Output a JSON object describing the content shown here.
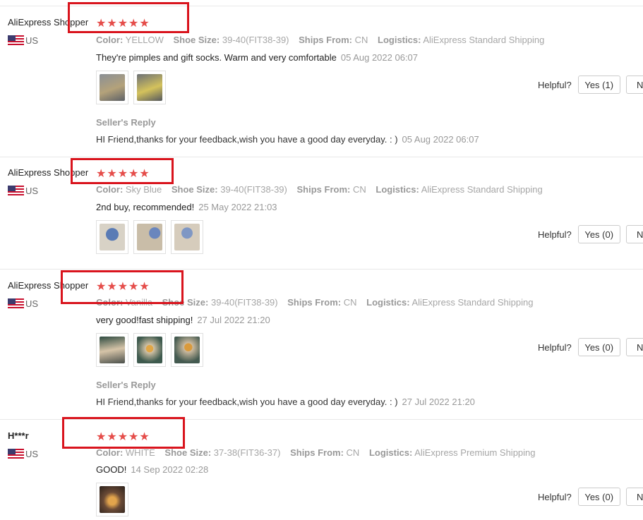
{
  "reviews": [
    {
      "user": "AliExpress Shopper",
      "country": "US",
      "stars": "★★★★★",
      "color_label": "Color:",
      "color": "YELLOW",
      "size_label": "Shoe Size:",
      "size": "39-40(FIT38-39)",
      "ships_label": "Ships From:",
      "ships": "CN",
      "logistics_label": "Logistics:",
      "logistics": "AliExpress Standard Shipping",
      "text": "They're pimples and gift socks. Warm and very comfortable",
      "date": "05 Aug 2022 06:07",
      "helpful_label": "Helpful?",
      "yes_label": "Yes (1)",
      "no_label": "N",
      "seller_reply_label": "Seller's Reply",
      "seller_reply": "HI Friend,thanks for your feedback,wish you have a good day everyday. : )",
      "seller_reply_date": "05 Aug 2022 06:07"
    },
    {
      "user": "AliExpress Shopper",
      "country": "US",
      "stars": "★★★★★",
      "color_label": "Color:",
      "color": "Sky Blue",
      "size_label": "Shoe Size:",
      "size": "39-40(FIT38-39)",
      "ships_label": "Ships From:",
      "ships": "CN",
      "logistics_label": "Logistics:",
      "logistics": "AliExpress Standard Shipping",
      "text": "2nd buy, recommended!",
      "date": "25 May 2022 21:03",
      "helpful_label": "Helpful?",
      "yes_label": "Yes (0)",
      "no_label": "N"
    },
    {
      "user": "AliExpress Shopper",
      "country": "US",
      "stars": "★★★★★",
      "color_label": "Color:",
      "color": "Vanilla",
      "size_label": "Shoe Size:",
      "size": "39-40(FIT38-39)",
      "ships_label": "Ships From:",
      "ships": "CN",
      "logistics_label": "Logistics:",
      "logistics": "AliExpress Standard Shipping",
      "text": "very good!fast shipping!",
      "date": "27 Jul 2022 21:20",
      "helpful_label": "Helpful?",
      "yes_label": "Yes (0)",
      "no_label": "N",
      "seller_reply_label": "Seller's Reply",
      "seller_reply": "HI Friend,thanks for your feedback,wish you have a good day everyday. : )",
      "seller_reply_date": "27 Jul 2022 21:20"
    },
    {
      "user": "H***r",
      "country": "US",
      "stars": "★★★★★",
      "color_label": "Color:",
      "color": "WHITE",
      "size_label": "Shoe Size:",
      "size": "37-38(FIT36-37)",
      "ships_label": "Ships From:",
      "ships": "CN",
      "logistics_label": "Logistics:",
      "logistics": "AliExpress Premium Shipping",
      "text": "GOOD!",
      "date": "14 Sep 2022 02:28",
      "helpful_label": "Helpful?",
      "yes_label": "Yes (0)",
      "no_label": "N"
    }
  ],
  "colors": {
    "star": "#e54d4a",
    "highlight_box": "#d9141d"
  }
}
